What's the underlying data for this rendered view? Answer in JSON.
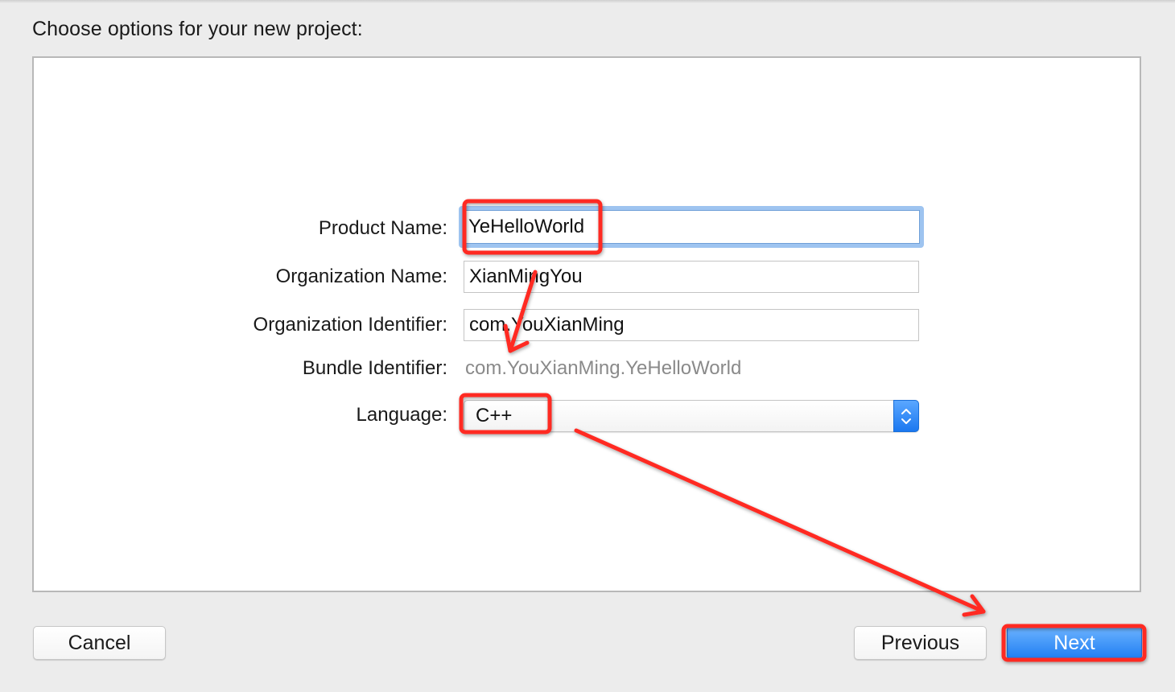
{
  "heading": "Choose options for your new project:",
  "form": {
    "product_name": {
      "label": "Product Name:",
      "value": "YeHelloWorld"
    },
    "organization_name": {
      "label": "Organization Name:",
      "value": "XianMingYou"
    },
    "organization_identifier": {
      "label": "Organization Identifier:",
      "value": "com.YouXianMing"
    },
    "bundle_identifier": {
      "label": "Bundle Identifier:",
      "value": "com.YouXianMing.YeHelloWorld"
    },
    "language": {
      "label": "Language:",
      "value": "C++"
    }
  },
  "buttons": {
    "cancel": "Cancel",
    "previous": "Previous",
    "next": "Next"
  },
  "colors": {
    "annotation": "#ff2a22",
    "accent": "#1f7ef2",
    "focus_ring": "#9ec4f0"
  },
  "icons": {
    "popup_stepper": "up-down-chevron-icon"
  }
}
